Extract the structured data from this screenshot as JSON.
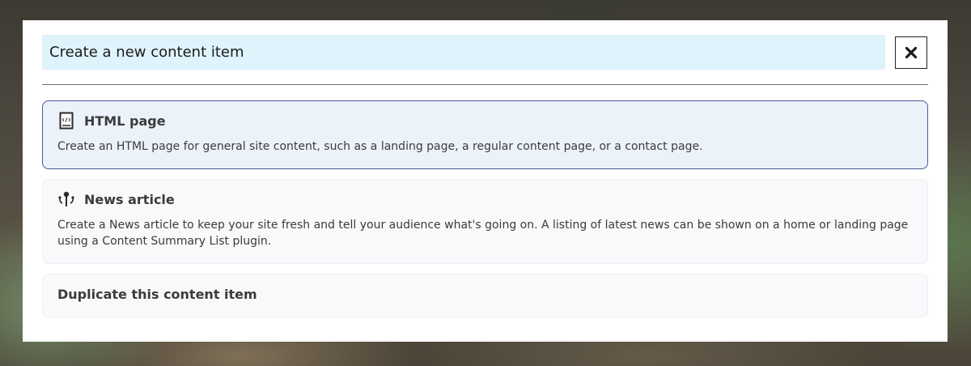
{
  "dialog": {
    "title": "Create a new content item",
    "close_icon": "close-icon"
  },
  "options": [
    {
      "icon": "html-file-icon",
      "title": "HTML page",
      "description": "Create an HTML page for general site content, such as a landing page, a regular content page, or a contact page.",
      "selected": true
    },
    {
      "icon": "news-article-icon",
      "title": "News article",
      "description": "Create a News article to keep your site fresh and tell your audience what's going on. A listing of latest news can be shown on a home or landing page using a Content Summary List plugin.",
      "selected": false
    },
    {
      "title": "Duplicate this content item",
      "selected": false
    }
  ],
  "colors": {
    "header_bg": "#def3fb",
    "selected_bg": "#ecf2fa",
    "selected_border": "#4a5896",
    "option_bg": "#f8f9fb"
  }
}
